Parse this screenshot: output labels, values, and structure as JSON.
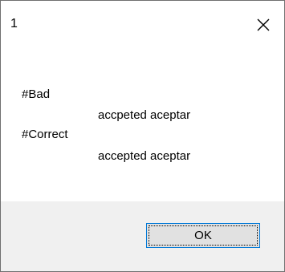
{
  "window": {
    "title": "1",
    "close_icon": "close-icon"
  },
  "message": {
    "lines": [
      "#Bad",
      "accpeted aceptar",
      "#Correct",
      "accepted aceptar"
    ]
  },
  "buttons": {
    "ok_label": "OK"
  },
  "colors": {
    "footer_bg": "#f0f0f0",
    "button_border_focus": "#0078d7",
    "button_bg": "#e1e1e1"
  }
}
